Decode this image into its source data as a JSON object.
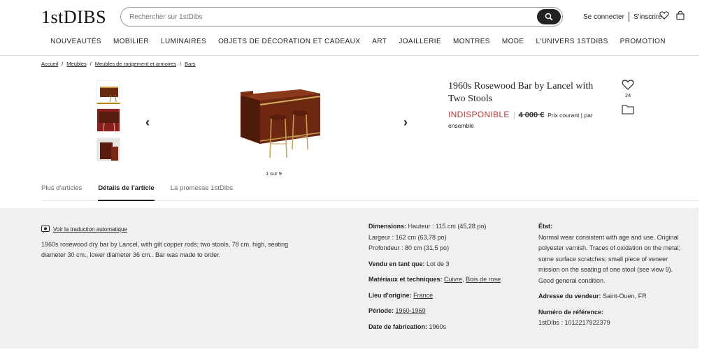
{
  "header": {
    "logo": "1stDIBS",
    "search_placeholder": "Rechercher sur 1stDibs",
    "login": "Se connecter",
    "signup": "S'inscrire"
  },
  "nav": [
    "NOUVEAUTÉS",
    "MOBILIER",
    "LUMINAIRES",
    "OBJETS DE DÉCORATION ET CADEAUX",
    "ART",
    "JOAILLERIE",
    "MONTRES",
    "MODE",
    "L'UNIVERS 1STDIBS",
    "PROMOTION"
  ],
  "breadcrumb": [
    "Accueil",
    "Meubles",
    "Meubles de rangement et armoires",
    "Bars"
  ],
  "gallery": {
    "counter": "1 sur 9"
  },
  "product": {
    "title": "1960s Rosewood Bar by Lancel with Two Stools",
    "status": "INDISPONIBLE",
    "old_price": "4 000 €",
    "price_note": "Prix courant | par ensemble",
    "favorites": "24"
  },
  "tabs": [
    "Plus d'articles",
    "Détails de l'article",
    "La promesse 1stDibs"
  ],
  "details": {
    "translate_link": "Voir la traduction automatique",
    "description": "1960s rosewood dry bar by Lancel, with gilt copper rods; two stools, 78 cm. high, seating diameter 30 cm., lower diameter 36 cm.. Bar was made to order.",
    "dimensions_label": "Dimensions:",
    "height": "Hauteur : 115 cm (45,28 po)",
    "width": "Largeur : 162 cm (63,78 po)",
    "depth": "Profondeur : 80 cm (31,5 po)",
    "sold_as_label": "Vendu en tant que:",
    "sold_as": "Lot de 3",
    "materials_label": "Matériaux et techniques:",
    "material_1": "Cuivre",
    "material_2": "Bois de rose",
    "origin_label": "Lieu d'origine:",
    "origin": "France",
    "period_label": "Période:",
    "period": "1960-1969",
    "made_label": "Date de fabrication:",
    "made": "1960s",
    "condition_label": "État:",
    "condition": "Normal wear consistent with age and use. Original polyester varnish. Traces of oxidation on the metal; some surface scratches; small piece of veneer mission on the seating of one stool (see view 9). Good general condition.",
    "seller_label": "Adresse du vendeur:",
    "seller": "Saint-Ouen, FR",
    "ref_label": "Numéro de référence:",
    "ref": "1stDibs : 1012217922379"
  },
  "colors": {
    "unavailable": "#b03a3a",
    "panel_bg": "#f0f0f0",
    "accent": "#b8860b"
  }
}
